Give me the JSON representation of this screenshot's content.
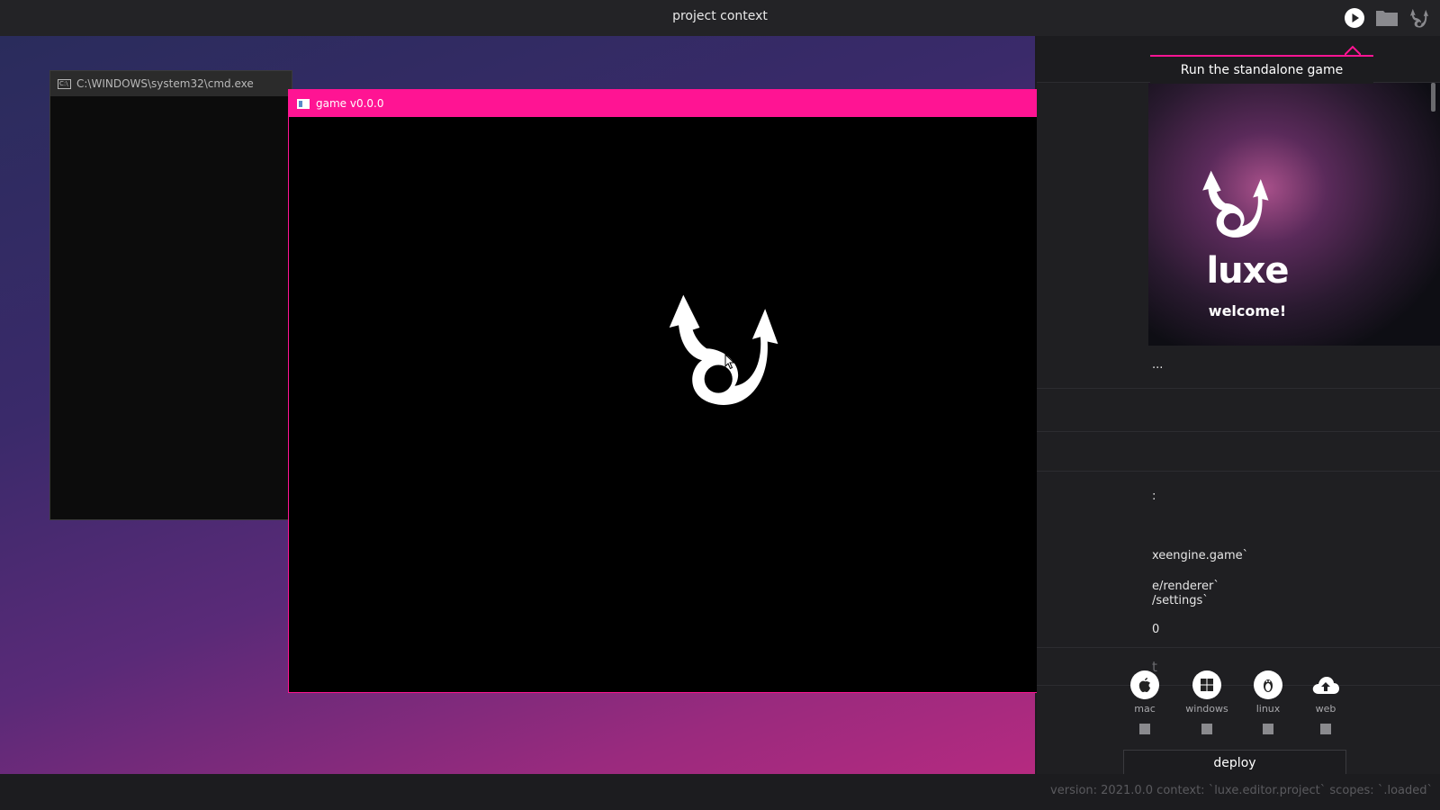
{
  "app": {
    "title": "project context"
  },
  "toolbar": {
    "run_icon": "play-icon",
    "folder_icon": "folder-icon",
    "logo_icon": "luxe-logo-icon"
  },
  "tooltip": {
    "text": "Run the standalone game"
  },
  "cmd_window": {
    "title": "C:\\WINDOWS\\system32\\cmd.exe",
    "icon_text": "C:\\"
  },
  "game_window": {
    "title": "game v0.0.0",
    "minimize": "—",
    "maximize": "□",
    "close": "✕"
  },
  "welcome": {
    "logo_text": "luxe",
    "greeting": "welcome!"
  },
  "panel": {
    "rows": [
      "...",
      "",
      "",
      ":",
      "xeengine.game`",
      "e/renderer`",
      "/settings`",
      "0",
      "t"
    ]
  },
  "platforms": [
    {
      "label": "mac",
      "icon": "apple-icon"
    },
    {
      "label": "windows",
      "icon": "windows-icon"
    },
    {
      "label": "linux",
      "icon": "linux-icon"
    },
    {
      "label": "web",
      "icon": "cloud-upload-icon"
    }
  ],
  "deploy": {
    "label": "deploy"
  },
  "status": {
    "text": "version: 2021.0.0 context: `luxe.editor.project` scopes: `.loaded`"
  },
  "colors": {
    "accent": "#ff1493",
    "titlebar": "#232326",
    "panel": "#1f1f22"
  }
}
